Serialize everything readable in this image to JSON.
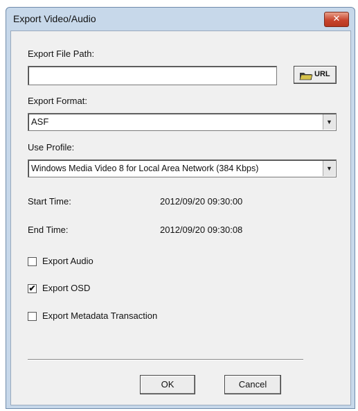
{
  "window": {
    "title": "Export Video/Audio",
    "close_glyph": "✕"
  },
  "export_path": {
    "label": "Export File Path:",
    "value": "",
    "button_icon": "folder-icon",
    "button_label": "URL"
  },
  "export_format": {
    "label": "Export Format:",
    "value": "ASF"
  },
  "profile": {
    "label": "Use Profile:",
    "value": "Windows Media Video 8 for Local Area Network (384 Kbps)"
  },
  "times": {
    "start_label": "Start Time:",
    "start_value": "2012/09/20 09:30:00",
    "end_label": "End Time:",
    "end_value": "2012/09/20 09:30:08"
  },
  "options": [
    {
      "label": "Export Audio",
      "checked": false
    },
    {
      "label": "Export OSD",
      "checked": true
    },
    {
      "label": "Export Metadata Transaction",
      "checked": false
    }
  ],
  "buttons": {
    "ok": "OK",
    "cancel": "Cancel"
  },
  "colors": {
    "title_bar": "#c7d8ea",
    "close_button": "#c8452e",
    "client_bg": "#f0f0f0"
  }
}
